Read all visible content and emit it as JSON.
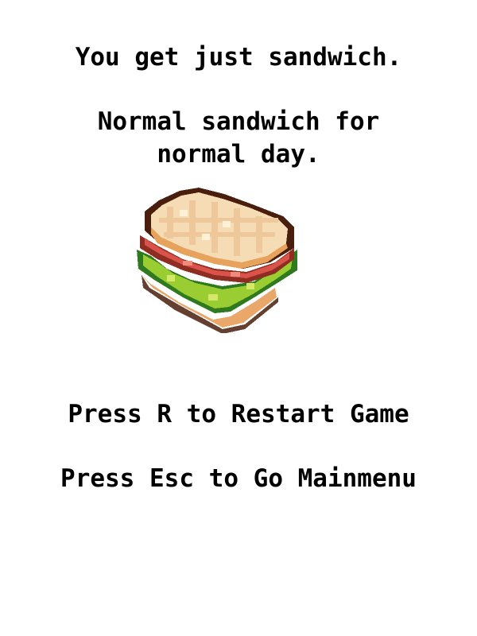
{
  "game_over": {
    "result_line": "You get just sandwich.",
    "flavor_line_1": "Normal sandwich for",
    "flavor_line_2": "normal day.",
    "reward_icon": "pixel-sandwich-icon"
  },
  "controls": {
    "restart_hint": "Press R to Restart Game",
    "menu_hint": "Press Esc to Go Mainmenu"
  },
  "colors": {
    "background": "#ffffff",
    "text": "#000000",
    "bread_outline": "#4a1e0c",
    "bread_light": "#f6dcb4",
    "bread_crust": "#e7a35c",
    "ham": "#d9534a",
    "lettuce": "#9acd32",
    "lettuce_dark": "#2f7a1e"
  }
}
